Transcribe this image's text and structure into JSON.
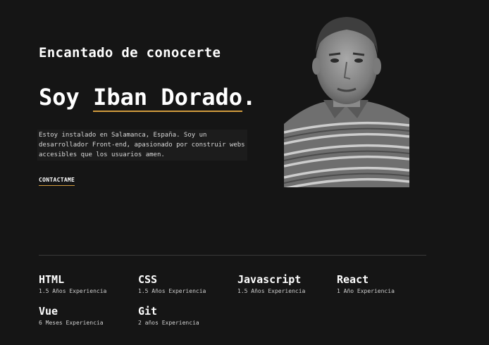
{
  "hero": {
    "greeting": "Encantado de conocerte",
    "title_prefix": "Soy ",
    "name": "Iban Dorado",
    "title_suffix": ".",
    "intro": "Estoy instalado en Salamanca, España. Soy un desarrollador Front-end, apasionado por construir webs accesibles que los usuarios amen.",
    "contact_label": "CONTACTAME"
  },
  "skills": [
    {
      "name": "HTML",
      "experience": "1.5 Años Experiencia"
    },
    {
      "name": "CSS",
      "experience": "1.5 Años Experiencia"
    },
    {
      "name": "Javascript",
      "experience": "1.5 Años Experiencia"
    },
    {
      "name": "React",
      "experience": "1 Año Experiencia"
    },
    {
      "name": "Vue",
      "experience": "6 Meses Experiencia"
    },
    {
      "name": "Git",
      "experience": "2 años Experiencia"
    }
  ],
  "colors": {
    "background": "#151515",
    "accent": "#d19b3d",
    "text": "#ffffff"
  }
}
